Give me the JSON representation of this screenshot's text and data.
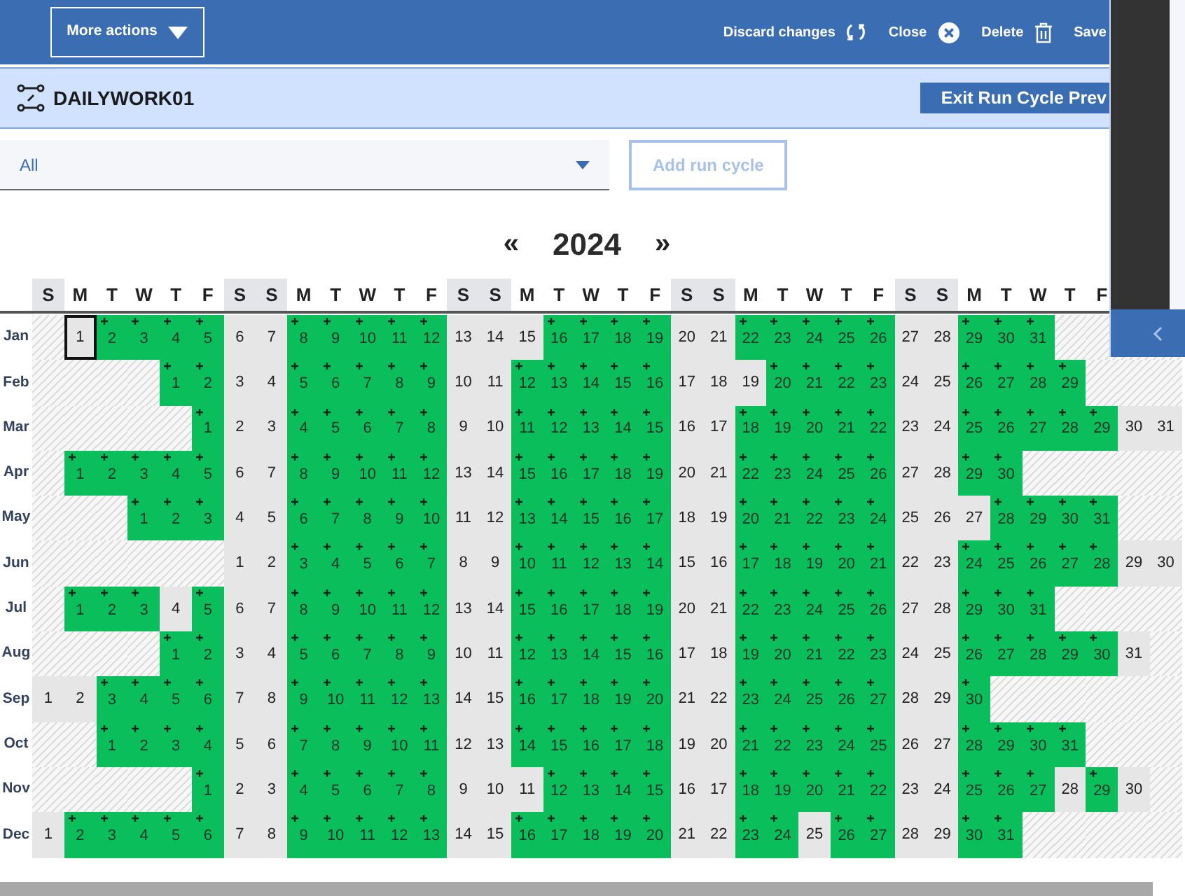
{
  "toolbar": {
    "menu_button": "More actions",
    "actions": [
      {
        "label": "Discard changes",
        "kind": "discard"
      },
      {
        "label": "Close",
        "kind": "close"
      },
      {
        "label": "Delete",
        "kind": "delete"
      },
      {
        "label": "Save",
        "kind": "save"
      }
    ]
  },
  "header": {
    "title": "DAILYWORK01",
    "exit_button": "Exit Run Cycle Prev"
  },
  "filter": {
    "value": "All"
  },
  "add_button": {
    "label": "Add run cycle",
    "disabled": true
  },
  "calendar": {
    "prev": "«",
    "year": "2024",
    "next": "»",
    "weekdays": [
      {
        "label": "S",
        "weekend": true
      },
      {
        "label": "M",
        "weekend": false
      },
      {
        "label": "T",
        "weekend": false
      },
      {
        "label": "W",
        "weekend": false
      },
      {
        "label": "T",
        "weekend": false
      },
      {
        "label": "F",
        "weekend": false
      },
      {
        "label": "S",
        "weekend": true
      },
      {
        "label": "S",
        "weekend": true
      },
      {
        "label": "M",
        "weekend": false
      },
      {
        "label": "T",
        "weekend": false
      },
      {
        "label": "W",
        "weekend": false
      },
      {
        "label": "T",
        "weekend": false
      },
      {
        "label": "F",
        "weekend": false
      },
      {
        "label": "S",
        "weekend": true
      },
      {
        "label": "S",
        "weekend": true
      },
      {
        "label": "M",
        "weekend": false
      },
      {
        "label": "T",
        "weekend": false
      },
      {
        "label": "W",
        "weekend": false
      },
      {
        "label": "T",
        "weekend": false
      },
      {
        "label": "F",
        "weekend": false
      },
      {
        "label": "S",
        "weekend": true
      },
      {
        "label": "S",
        "weekend": true
      },
      {
        "label": "M",
        "weekend": false
      },
      {
        "label": "T",
        "weekend": false
      },
      {
        "label": "W",
        "weekend": false
      },
      {
        "label": "T",
        "weekend": false
      },
      {
        "label": "F",
        "weekend": false
      },
      {
        "label": "S",
        "weekend": true
      },
      {
        "label": "S",
        "weekend": true
      },
      {
        "label": "M",
        "weekend": false
      },
      {
        "label": "T",
        "weekend": false
      },
      {
        "label": "W",
        "weekend": false
      },
      {
        "label": "T",
        "weekend": false
      },
      {
        "label": "F",
        "weekend": false
      }
    ],
    "months": [
      {
        "name": "Jan",
        "cells": [
          {
            "kind": "outside"
          },
          {
            "kind": "marked",
            "day": "1"
          },
          {
            "kind": "run",
            "day": "2"
          },
          {
            "kind": "run",
            "day": "3"
          },
          {
            "kind": "run",
            "day": "4"
          },
          {
            "kind": "run",
            "day": "5"
          },
          {
            "kind": "free",
            "day": "6"
          },
          {
            "kind": "free",
            "day": "7"
          },
          {
            "kind": "run",
            "day": "8"
          },
          {
            "kind": "run",
            "day": "9"
          },
          {
            "kind": "run",
            "day": "10"
          },
          {
            "kind": "run",
            "day": "11"
          },
          {
            "kind": "run",
            "day": "12"
          },
          {
            "kind": "free",
            "day": "13"
          },
          {
            "kind": "free",
            "day": "14"
          },
          {
            "kind": "free",
            "day": "15"
          },
          {
            "kind": "run",
            "day": "16"
          },
          {
            "kind": "run",
            "day": "17"
          },
          {
            "kind": "run",
            "day": "18"
          },
          {
            "kind": "run",
            "day": "19"
          },
          {
            "kind": "free",
            "day": "20"
          },
          {
            "kind": "free",
            "day": "21"
          },
          {
            "kind": "run",
            "day": "22"
          },
          {
            "kind": "run",
            "day": "23"
          },
          {
            "kind": "run",
            "day": "24"
          },
          {
            "kind": "run",
            "day": "25"
          },
          {
            "kind": "run",
            "day": "26"
          },
          {
            "kind": "free",
            "day": "27"
          },
          {
            "kind": "free",
            "day": "28"
          },
          {
            "kind": "run",
            "day": "29"
          },
          {
            "kind": "run",
            "day": "30"
          },
          {
            "kind": "run",
            "day": "31"
          },
          {
            "kind": "outside"
          },
          {
            "kind": "outside"
          },
          {
            "kind": "outside"
          },
          {
            "kind": "outside"
          }
        ]
      },
      {
        "name": "Feb",
        "cells": [
          {
            "kind": "outside"
          },
          {
            "kind": "outside"
          },
          {
            "kind": "outside"
          },
          {
            "kind": "outside"
          },
          {
            "kind": "run",
            "day": "1"
          },
          {
            "kind": "run",
            "day": "2"
          },
          {
            "kind": "free",
            "day": "3"
          },
          {
            "kind": "free",
            "day": "4"
          },
          {
            "kind": "run",
            "day": "5"
          },
          {
            "kind": "run",
            "day": "6"
          },
          {
            "kind": "run",
            "day": "7"
          },
          {
            "kind": "run",
            "day": "8"
          },
          {
            "kind": "run",
            "day": "9"
          },
          {
            "kind": "free",
            "day": "10"
          },
          {
            "kind": "free",
            "day": "11"
          },
          {
            "kind": "run",
            "day": "12"
          },
          {
            "kind": "run",
            "day": "13"
          },
          {
            "kind": "run",
            "day": "14"
          },
          {
            "kind": "run",
            "day": "15"
          },
          {
            "kind": "run",
            "day": "16"
          },
          {
            "kind": "free",
            "day": "17"
          },
          {
            "kind": "free",
            "day": "18"
          },
          {
            "kind": "free",
            "day": "19"
          },
          {
            "kind": "run",
            "day": "20"
          },
          {
            "kind": "run",
            "day": "21"
          },
          {
            "kind": "run",
            "day": "22"
          },
          {
            "kind": "run",
            "day": "23"
          },
          {
            "kind": "free",
            "day": "24"
          },
          {
            "kind": "free",
            "day": "25"
          },
          {
            "kind": "run",
            "day": "26"
          },
          {
            "kind": "run",
            "day": "27"
          },
          {
            "kind": "run",
            "day": "28"
          },
          {
            "kind": "run",
            "day": "29"
          },
          {
            "kind": "outside"
          },
          {
            "kind": "outside"
          },
          {
            "kind": "outside"
          }
        ]
      },
      {
        "name": "Mar",
        "cells": [
          {
            "kind": "outside"
          },
          {
            "kind": "outside"
          },
          {
            "kind": "outside"
          },
          {
            "kind": "outside"
          },
          {
            "kind": "outside"
          },
          {
            "kind": "run",
            "day": "1"
          },
          {
            "kind": "free",
            "day": "2"
          },
          {
            "kind": "free",
            "day": "3"
          },
          {
            "kind": "run",
            "day": "4"
          },
          {
            "kind": "run",
            "day": "5"
          },
          {
            "kind": "run",
            "day": "6"
          },
          {
            "kind": "run",
            "day": "7"
          },
          {
            "kind": "run",
            "day": "8"
          },
          {
            "kind": "free",
            "day": "9"
          },
          {
            "kind": "free",
            "day": "10"
          },
          {
            "kind": "run",
            "day": "11"
          },
          {
            "kind": "run",
            "day": "12"
          },
          {
            "kind": "run",
            "day": "13"
          },
          {
            "kind": "run",
            "day": "14"
          },
          {
            "kind": "run",
            "day": "15"
          },
          {
            "kind": "free",
            "day": "16"
          },
          {
            "kind": "free",
            "day": "17"
          },
          {
            "kind": "run",
            "day": "18"
          },
          {
            "kind": "run",
            "day": "19"
          },
          {
            "kind": "run",
            "day": "20"
          },
          {
            "kind": "run",
            "day": "21"
          },
          {
            "kind": "run",
            "day": "22"
          },
          {
            "kind": "free",
            "day": "23"
          },
          {
            "kind": "free",
            "day": "24"
          },
          {
            "kind": "run",
            "day": "25"
          },
          {
            "kind": "run",
            "day": "26"
          },
          {
            "kind": "run",
            "day": "27"
          },
          {
            "kind": "run",
            "day": "28"
          },
          {
            "kind": "run",
            "day": "29"
          },
          {
            "kind": "free",
            "day": "30"
          },
          {
            "kind": "free",
            "day": "31"
          }
        ]
      },
      {
        "name": "Apr",
        "cells": [
          {
            "kind": "outside"
          },
          {
            "kind": "run",
            "day": "1"
          },
          {
            "kind": "run",
            "day": "2"
          },
          {
            "kind": "run",
            "day": "3"
          },
          {
            "kind": "run",
            "day": "4"
          },
          {
            "kind": "run",
            "day": "5"
          },
          {
            "kind": "free",
            "day": "6"
          },
          {
            "kind": "free",
            "day": "7"
          },
          {
            "kind": "run",
            "day": "8"
          },
          {
            "kind": "run",
            "day": "9"
          },
          {
            "kind": "run",
            "day": "10"
          },
          {
            "kind": "run",
            "day": "11"
          },
          {
            "kind": "run",
            "day": "12"
          },
          {
            "kind": "free",
            "day": "13"
          },
          {
            "kind": "free",
            "day": "14"
          },
          {
            "kind": "run",
            "day": "15"
          },
          {
            "kind": "run",
            "day": "16"
          },
          {
            "kind": "run",
            "day": "17"
          },
          {
            "kind": "run",
            "day": "18"
          },
          {
            "kind": "run",
            "day": "19"
          },
          {
            "kind": "free",
            "day": "20"
          },
          {
            "kind": "free",
            "day": "21"
          },
          {
            "kind": "run",
            "day": "22"
          },
          {
            "kind": "run",
            "day": "23"
          },
          {
            "kind": "run",
            "day": "24"
          },
          {
            "kind": "run",
            "day": "25"
          },
          {
            "kind": "run",
            "day": "26"
          },
          {
            "kind": "free",
            "day": "27"
          },
          {
            "kind": "free",
            "day": "28"
          },
          {
            "kind": "run",
            "day": "29"
          },
          {
            "kind": "run",
            "day": "30"
          },
          {
            "kind": "outside"
          },
          {
            "kind": "outside"
          },
          {
            "kind": "outside"
          },
          {
            "kind": "outside"
          },
          {
            "kind": "outside"
          }
        ]
      },
      {
        "name": "May",
        "cells": [
          {
            "kind": "outside"
          },
          {
            "kind": "outside"
          },
          {
            "kind": "outside"
          },
          {
            "kind": "run",
            "day": "1"
          },
          {
            "kind": "run",
            "day": "2"
          },
          {
            "kind": "run",
            "day": "3"
          },
          {
            "kind": "free",
            "day": "4"
          },
          {
            "kind": "free",
            "day": "5"
          },
          {
            "kind": "run",
            "day": "6"
          },
          {
            "kind": "run",
            "day": "7"
          },
          {
            "kind": "run",
            "day": "8"
          },
          {
            "kind": "run",
            "day": "9"
          },
          {
            "kind": "run",
            "day": "10"
          },
          {
            "kind": "free",
            "day": "11"
          },
          {
            "kind": "free",
            "day": "12"
          },
          {
            "kind": "run",
            "day": "13"
          },
          {
            "kind": "run",
            "day": "14"
          },
          {
            "kind": "run",
            "day": "15"
          },
          {
            "kind": "run",
            "day": "16"
          },
          {
            "kind": "run",
            "day": "17"
          },
          {
            "kind": "free",
            "day": "18"
          },
          {
            "kind": "free",
            "day": "19"
          },
          {
            "kind": "run",
            "day": "20"
          },
          {
            "kind": "run",
            "day": "21"
          },
          {
            "kind": "run",
            "day": "22"
          },
          {
            "kind": "run",
            "day": "23"
          },
          {
            "kind": "run",
            "day": "24"
          },
          {
            "kind": "free",
            "day": "25"
          },
          {
            "kind": "free",
            "day": "26"
          },
          {
            "kind": "free",
            "day": "27"
          },
          {
            "kind": "run",
            "day": "28"
          },
          {
            "kind": "run",
            "day": "29"
          },
          {
            "kind": "run",
            "day": "30"
          },
          {
            "kind": "run",
            "day": "31"
          },
          {
            "kind": "outside"
          },
          {
            "kind": "outside"
          }
        ]
      },
      {
        "name": "Jun",
        "cells": [
          {
            "kind": "outside"
          },
          {
            "kind": "outside"
          },
          {
            "kind": "outside"
          },
          {
            "kind": "outside"
          },
          {
            "kind": "outside"
          },
          {
            "kind": "outside"
          },
          {
            "kind": "free",
            "day": "1"
          },
          {
            "kind": "free",
            "day": "2"
          },
          {
            "kind": "run",
            "day": "3"
          },
          {
            "kind": "run",
            "day": "4"
          },
          {
            "kind": "run",
            "day": "5"
          },
          {
            "kind": "run",
            "day": "6"
          },
          {
            "kind": "run",
            "day": "7"
          },
          {
            "kind": "free",
            "day": "8"
          },
          {
            "kind": "free",
            "day": "9"
          },
          {
            "kind": "run",
            "day": "10"
          },
          {
            "kind": "run",
            "day": "11"
          },
          {
            "kind": "run",
            "day": "12"
          },
          {
            "kind": "run",
            "day": "13"
          },
          {
            "kind": "run",
            "day": "14"
          },
          {
            "kind": "free",
            "day": "15"
          },
          {
            "kind": "free",
            "day": "16"
          },
          {
            "kind": "run",
            "day": "17"
          },
          {
            "kind": "run",
            "day": "18"
          },
          {
            "kind": "run",
            "day": "19"
          },
          {
            "kind": "run",
            "day": "20"
          },
          {
            "kind": "run",
            "day": "21"
          },
          {
            "kind": "free",
            "day": "22"
          },
          {
            "kind": "free",
            "day": "23"
          },
          {
            "kind": "run",
            "day": "24"
          },
          {
            "kind": "run",
            "day": "25"
          },
          {
            "kind": "run",
            "day": "26"
          },
          {
            "kind": "run",
            "day": "27"
          },
          {
            "kind": "run",
            "day": "28"
          },
          {
            "kind": "free",
            "day": "29"
          },
          {
            "kind": "free",
            "day": "30"
          }
        ]
      },
      {
        "name": "Jul",
        "cells": [
          {
            "kind": "outside"
          },
          {
            "kind": "run",
            "day": "1"
          },
          {
            "kind": "run",
            "day": "2"
          },
          {
            "kind": "run",
            "day": "3"
          },
          {
            "kind": "free",
            "day": "4"
          },
          {
            "kind": "run",
            "day": "5"
          },
          {
            "kind": "free",
            "day": "6"
          },
          {
            "kind": "free",
            "day": "7"
          },
          {
            "kind": "run",
            "day": "8"
          },
          {
            "kind": "run",
            "day": "9"
          },
          {
            "kind": "run",
            "day": "10"
          },
          {
            "kind": "run",
            "day": "11"
          },
          {
            "kind": "run",
            "day": "12"
          },
          {
            "kind": "free",
            "day": "13"
          },
          {
            "kind": "free",
            "day": "14"
          },
          {
            "kind": "run",
            "day": "15"
          },
          {
            "kind": "run",
            "day": "16"
          },
          {
            "kind": "run",
            "day": "17"
          },
          {
            "kind": "run",
            "day": "18"
          },
          {
            "kind": "run",
            "day": "19"
          },
          {
            "kind": "free",
            "day": "20"
          },
          {
            "kind": "free",
            "day": "21"
          },
          {
            "kind": "run",
            "day": "22"
          },
          {
            "kind": "run",
            "day": "23"
          },
          {
            "kind": "run",
            "day": "24"
          },
          {
            "kind": "run",
            "day": "25"
          },
          {
            "kind": "run",
            "day": "26"
          },
          {
            "kind": "free",
            "day": "27"
          },
          {
            "kind": "free",
            "day": "28"
          },
          {
            "kind": "run",
            "day": "29"
          },
          {
            "kind": "run",
            "day": "30"
          },
          {
            "kind": "run",
            "day": "31"
          },
          {
            "kind": "outside"
          },
          {
            "kind": "outside"
          },
          {
            "kind": "outside"
          },
          {
            "kind": "outside"
          }
        ]
      },
      {
        "name": "Aug",
        "cells": [
          {
            "kind": "outside"
          },
          {
            "kind": "outside"
          },
          {
            "kind": "outside"
          },
          {
            "kind": "outside"
          },
          {
            "kind": "run",
            "day": "1"
          },
          {
            "kind": "run",
            "day": "2"
          },
          {
            "kind": "free",
            "day": "3"
          },
          {
            "kind": "free",
            "day": "4"
          },
          {
            "kind": "run",
            "day": "5"
          },
          {
            "kind": "run",
            "day": "6"
          },
          {
            "kind": "run",
            "day": "7"
          },
          {
            "kind": "run",
            "day": "8"
          },
          {
            "kind": "run",
            "day": "9"
          },
          {
            "kind": "free",
            "day": "10"
          },
          {
            "kind": "free",
            "day": "11"
          },
          {
            "kind": "run",
            "day": "12"
          },
          {
            "kind": "run",
            "day": "13"
          },
          {
            "kind": "run",
            "day": "14"
          },
          {
            "kind": "run",
            "day": "15"
          },
          {
            "kind": "run",
            "day": "16"
          },
          {
            "kind": "free",
            "day": "17"
          },
          {
            "kind": "free",
            "day": "18"
          },
          {
            "kind": "run",
            "day": "19"
          },
          {
            "kind": "run",
            "day": "20"
          },
          {
            "kind": "run",
            "day": "21"
          },
          {
            "kind": "run",
            "day": "22"
          },
          {
            "kind": "run",
            "day": "23"
          },
          {
            "kind": "free",
            "day": "24"
          },
          {
            "kind": "free",
            "day": "25"
          },
          {
            "kind": "run",
            "day": "26"
          },
          {
            "kind": "run",
            "day": "27"
          },
          {
            "kind": "run",
            "day": "28"
          },
          {
            "kind": "run",
            "day": "29"
          },
          {
            "kind": "run",
            "day": "30"
          },
          {
            "kind": "free",
            "day": "31"
          },
          {
            "kind": "outside"
          }
        ]
      },
      {
        "name": "Sep",
        "cells": [
          {
            "kind": "free",
            "day": "1"
          },
          {
            "kind": "free",
            "day": "2"
          },
          {
            "kind": "run",
            "day": "3"
          },
          {
            "kind": "run",
            "day": "4"
          },
          {
            "kind": "run",
            "day": "5"
          },
          {
            "kind": "run",
            "day": "6"
          },
          {
            "kind": "free",
            "day": "7"
          },
          {
            "kind": "free",
            "day": "8"
          },
          {
            "kind": "run",
            "day": "9"
          },
          {
            "kind": "run",
            "day": "10"
          },
          {
            "kind": "run",
            "day": "11"
          },
          {
            "kind": "run",
            "day": "12"
          },
          {
            "kind": "run",
            "day": "13"
          },
          {
            "kind": "free",
            "day": "14"
          },
          {
            "kind": "free",
            "day": "15"
          },
          {
            "kind": "run",
            "day": "16"
          },
          {
            "kind": "run",
            "day": "17"
          },
          {
            "kind": "run",
            "day": "18"
          },
          {
            "kind": "run",
            "day": "19"
          },
          {
            "kind": "run",
            "day": "20"
          },
          {
            "kind": "free",
            "day": "21"
          },
          {
            "kind": "free",
            "day": "22"
          },
          {
            "kind": "run",
            "day": "23"
          },
          {
            "kind": "run",
            "day": "24"
          },
          {
            "kind": "run",
            "day": "25"
          },
          {
            "kind": "run",
            "day": "26"
          },
          {
            "kind": "run",
            "day": "27"
          },
          {
            "kind": "free",
            "day": "28"
          },
          {
            "kind": "free",
            "day": "29"
          },
          {
            "kind": "run",
            "day": "30"
          },
          {
            "kind": "outside"
          },
          {
            "kind": "outside"
          },
          {
            "kind": "outside"
          },
          {
            "kind": "outside"
          },
          {
            "kind": "outside"
          },
          {
            "kind": "outside"
          }
        ]
      },
      {
        "name": "Oct",
        "cells": [
          {
            "kind": "outside"
          },
          {
            "kind": "outside"
          },
          {
            "kind": "run",
            "day": "1"
          },
          {
            "kind": "run",
            "day": "2"
          },
          {
            "kind": "run",
            "day": "3"
          },
          {
            "kind": "run",
            "day": "4"
          },
          {
            "kind": "free",
            "day": "5"
          },
          {
            "kind": "free",
            "day": "6"
          },
          {
            "kind": "run",
            "day": "7"
          },
          {
            "kind": "run",
            "day": "8"
          },
          {
            "kind": "run",
            "day": "9"
          },
          {
            "kind": "run",
            "day": "10"
          },
          {
            "kind": "run",
            "day": "11"
          },
          {
            "kind": "free",
            "day": "12"
          },
          {
            "kind": "free",
            "day": "13"
          },
          {
            "kind": "run",
            "day": "14"
          },
          {
            "kind": "run",
            "day": "15"
          },
          {
            "kind": "run",
            "day": "16"
          },
          {
            "kind": "run",
            "day": "17"
          },
          {
            "kind": "run",
            "day": "18"
          },
          {
            "kind": "free",
            "day": "19"
          },
          {
            "kind": "free",
            "day": "20"
          },
          {
            "kind": "run",
            "day": "21"
          },
          {
            "kind": "run",
            "day": "22"
          },
          {
            "kind": "run",
            "day": "23"
          },
          {
            "kind": "run",
            "day": "24"
          },
          {
            "kind": "run",
            "day": "25"
          },
          {
            "kind": "free",
            "day": "26"
          },
          {
            "kind": "free",
            "day": "27"
          },
          {
            "kind": "run",
            "day": "28"
          },
          {
            "kind": "run",
            "day": "29"
          },
          {
            "kind": "run",
            "day": "30"
          },
          {
            "kind": "run",
            "day": "31"
          },
          {
            "kind": "outside"
          },
          {
            "kind": "outside"
          },
          {
            "kind": "outside"
          }
        ]
      },
      {
        "name": "Nov",
        "cells": [
          {
            "kind": "outside"
          },
          {
            "kind": "outside"
          },
          {
            "kind": "outside"
          },
          {
            "kind": "outside"
          },
          {
            "kind": "outside"
          },
          {
            "kind": "run",
            "day": "1"
          },
          {
            "kind": "free",
            "day": "2"
          },
          {
            "kind": "free",
            "day": "3"
          },
          {
            "kind": "run",
            "day": "4"
          },
          {
            "kind": "run",
            "day": "5"
          },
          {
            "kind": "run",
            "day": "6"
          },
          {
            "kind": "run",
            "day": "7"
          },
          {
            "kind": "run",
            "day": "8"
          },
          {
            "kind": "free",
            "day": "9"
          },
          {
            "kind": "free",
            "day": "10"
          },
          {
            "kind": "free",
            "day": "11"
          },
          {
            "kind": "run",
            "day": "12"
          },
          {
            "kind": "run",
            "day": "13"
          },
          {
            "kind": "run",
            "day": "14"
          },
          {
            "kind": "run",
            "day": "15"
          },
          {
            "kind": "free",
            "day": "16"
          },
          {
            "kind": "free",
            "day": "17"
          },
          {
            "kind": "run",
            "day": "18"
          },
          {
            "kind": "run",
            "day": "19"
          },
          {
            "kind": "run",
            "day": "20"
          },
          {
            "kind": "run",
            "day": "21"
          },
          {
            "kind": "run",
            "day": "22"
          },
          {
            "kind": "free",
            "day": "23"
          },
          {
            "kind": "free",
            "day": "24"
          },
          {
            "kind": "run",
            "day": "25"
          },
          {
            "kind": "run",
            "day": "26"
          },
          {
            "kind": "run",
            "day": "27"
          },
          {
            "kind": "free",
            "day": "28"
          },
          {
            "kind": "run",
            "day": "29"
          },
          {
            "kind": "free",
            "day": "30"
          },
          {
            "kind": "outside"
          }
        ]
      },
      {
        "name": "Dec",
        "cells": [
          {
            "kind": "free",
            "day": "1"
          },
          {
            "kind": "run",
            "day": "2"
          },
          {
            "kind": "run",
            "day": "3"
          },
          {
            "kind": "run",
            "day": "4"
          },
          {
            "kind": "run",
            "day": "5"
          },
          {
            "kind": "run",
            "day": "6"
          },
          {
            "kind": "free",
            "day": "7"
          },
          {
            "kind": "free",
            "day": "8"
          },
          {
            "kind": "run",
            "day": "9"
          },
          {
            "kind": "run",
            "day": "10"
          },
          {
            "kind": "run",
            "day": "11"
          },
          {
            "kind": "run",
            "day": "12"
          },
          {
            "kind": "run",
            "day": "13"
          },
          {
            "kind": "free",
            "day": "14"
          },
          {
            "kind": "free",
            "day": "15"
          },
          {
            "kind": "run",
            "day": "16"
          },
          {
            "kind": "run",
            "day": "17"
          },
          {
            "kind": "run",
            "day": "18"
          },
          {
            "kind": "run",
            "day": "19"
          },
          {
            "kind": "run",
            "day": "20"
          },
          {
            "kind": "free",
            "day": "21"
          },
          {
            "kind": "free",
            "day": "22"
          },
          {
            "kind": "run",
            "day": "23"
          },
          {
            "kind": "run",
            "day": "24"
          },
          {
            "kind": "free",
            "day": "25"
          },
          {
            "kind": "run",
            "day": "26"
          },
          {
            "kind": "run",
            "day": "27"
          },
          {
            "kind": "free",
            "day": "28"
          },
          {
            "kind": "free",
            "day": "29"
          },
          {
            "kind": "run",
            "day": "30"
          },
          {
            "kind": "run",
            "day": "31"
          },
          {
            "kind": "outside"
          },
          {
            "kind": "outside"
          },
          {
            "kind": "outside"
          },
          {
            "kind": "outside"
          },
          {
            "kind": "outside"
          }
        ]
      }
    ]
  }
}
